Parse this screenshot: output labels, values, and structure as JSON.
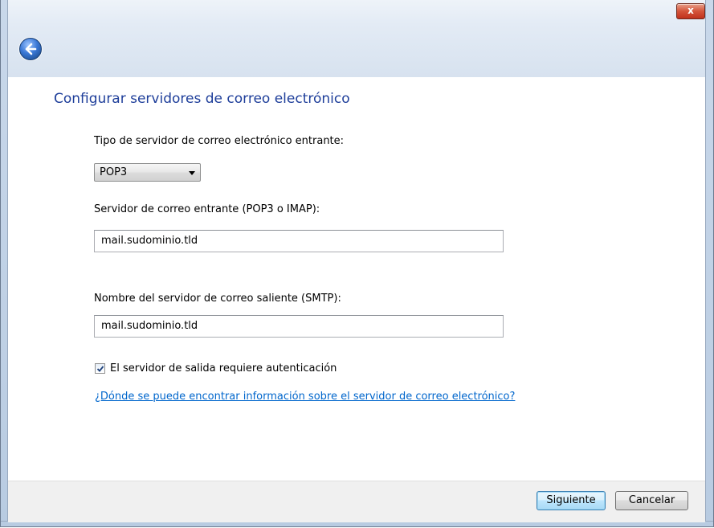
{
  "window": {
    "close_glyph": "x"
  },
  "page": {
    "title": "Configurar servidores de correo electrónico"
  },
  "incoming_type": {
    "label": "Tipo de servidor de correo electrónico entrante:",
    "selected": "POP3"
  },
  "incoming_server": {
    "label": "Servidor de correo entrante (POP3 o IMAP):",
    "value": "mail.sudominio.tld"
  },
  "outgoing_server": {
    "label": "Nombre del servidor de correo saliente (SMTP):",
    "value": "mail.sudominio.tld"
  },
  "auth": {
    "label": "El servidor de salida requiere autenticación",
    "checked": true
  },
  "help_link": "¿Dónde se puede encontrar información sobre el servidor de correo electrónico?",
  "footer": {
    "next_label": "Siguiente",
    "cancel_label": "Cancelar"
  },
  "icons": [
    "back-arrow-icon",
    "close-icon",
    "checkmark-icon",
    "dropdown-arrow-icon"
  ],
  "colors": {
    "title": "#1e3e9a",
    "link": "#0066cc",
    "close_button": "#c0311c"
  }
}
